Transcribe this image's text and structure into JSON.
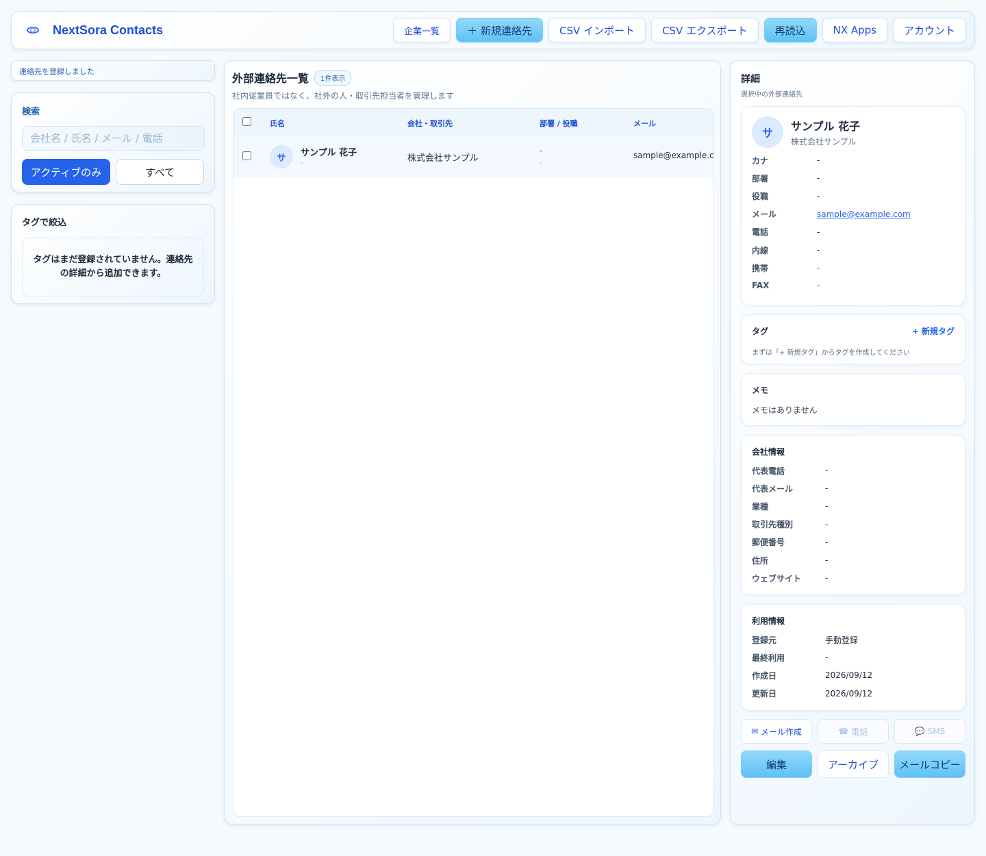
{
  "header": {
    "app_title": "NextSora Contacts",
    "nav": [
      "企業一覧",
      "＋ 新規連絡先",
      "CSV インポート",
      "CSV エクスポート",
      "再読込",
      "NX Apps",
      "アカウント"
    ]
  },
  "toast": "連絡先を登録しました",
  "search": {
    "label": "検索",
    "placeholder": "会社名 / 氏名 / メール / 電話",
    "filter_active": "アクティブのみ",
    "filter_all": "すべて"
  },
  "tags_filter": {
    "label": "タグで絞込",
    "empty": "タグはまだ登録されていません。連絡先の詳細から追加できます。"
  },
  "list": {
    "title": "外部連絡先一覧",
    "count": "1件表示",
    "subtitle": "社内従業員ではなく、社外の人・取引先担当者を管理します",
    "columns": [
      "氏名",
      "会社・取引先",
      "部署 / 役職",
      "メール"
    ],
    "rows": [
      {
        "avatar": "サ",
        "name": "サンプル 花子",
        "name_sub": "-",
        "company": "株式会社サンプル",
        "dept": "-",
        "role": "-",
        "email": "sample@example.com"
      }
    ]
  },
  "detail": {
    "title": "詳細",
    "subtitle": "選択中の外部連絡先",
    "avatar": "サ",
    "name": "サンプル 花子",
    "company": "株式会社サンプル",
    "fields": [
      {
        "k": "カナ",
        "v": "-"
      },
      {
        "k": "部署",
        "v": "-"
      },
      {
        "k": "役職",
        "v": "-"
      },
      {
        "k": "メール",
        "v": "sample@example.com"
      },
      {
        "k": "電話",
        "v": "-"
      },
      {
        "k": "内線",
        "v": "-"
      },
      {
        "k": "携帯",
        "v": "-"
      },
      {
        "k": "FAX",
        "v": "-"
      }
    ],
    "tags_label": "タグ",
    "new_tag": "+ 新規タグ",
    "tags_hint": "まずは「+ 新規タグ」からタグを作成してください",
    "memo_label": "メモ",
    "memo_text": "メモはありません",
    "company_info_label": "会社情報",
    "company_info": [
      {
        "k": "代表電話",
        "v": "-"
      },
      {
        "k": "代表メール",
        "v": "-"
      },
      {
        "k": "業種",
        "v": "-"
      },
      {
        "k": "取引先種別",
        "v": "-"
      },
      {
        "k": "郵便番号",
        "v": "-"
      },
      {
        "k": "住所",
        "v": "-"
      },
      {
        "k": "ウェブサイト",
        "v": "-"
      }
    ],
    "usage_label": "利用情報",
    "usage": [
      {
        "k": "登録元",
        "v": "手動登録"
      },
      {
        "k": "最終利用",
        "v": "-"
      },
      {
        "k": "作成日",
        "v": "2026/09/12"
      },
      {
        "k": "更新日",
        "v": "2026/09/12"
      }
    ],
    "actions": {
      "mail": "メール作成",
      "phone": "電話",
      "sms": "SMS",
      "edit": "編集",
      "archive": "アーカイブ",
      "copy_mail": "メールコピー"
    }
  }
}
